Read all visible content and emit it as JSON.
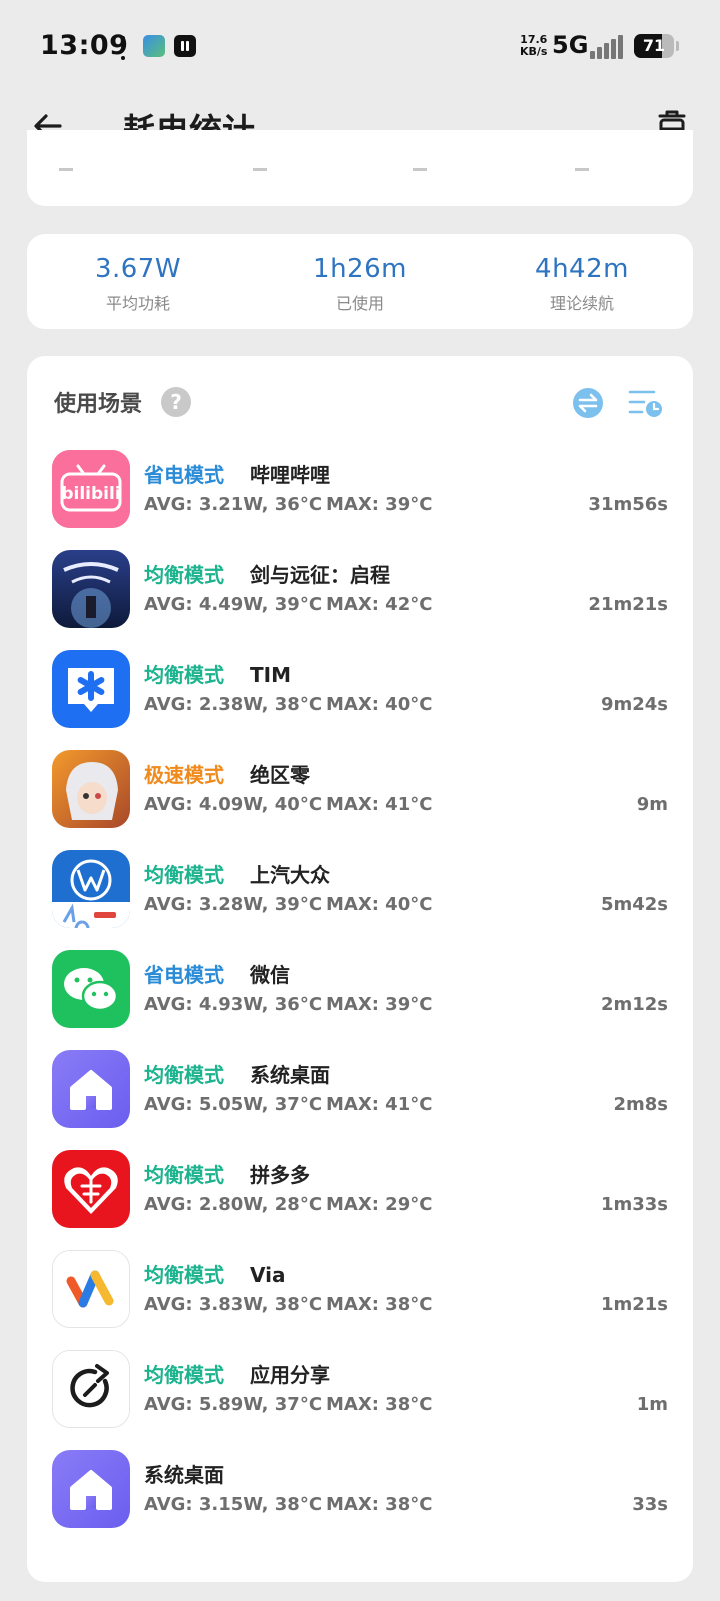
{
  "status_bar": {
    "time": "13:09",
    "net_speed_value": "17.6",
    "net_speed_unit": "KB/s",
    "network": "5G",
    "battery_level": "71",
    "battery_fraction": 0.71
  },
  "header": {
    "title": "耗电统计",
    "back_icon": "arrow-left-icon",
    "action_icon": "trash-icon"
  },
  "summary": [
    {
      "value": "3.67W",
      "label": "平均功耗"
    },
    {
      "value": "1h26m",
      "label": "已使用"
    },
    {
      "value": "4h42m",
      "label": "理论续航"
    }
  ],
  "scenes": {
    "title": "使用场景",
    "help_glyph": "?",
    "apps": [
      {
        "mode": "省电模式",
        "mode_color": "#2a8bd6",
        "name": "哔哩哔哩",
        "avg": "AVG: 3.21W, 36°C",
        "max": "MAX:  39°C",
        "duration": "31m56s",
        "icon": "bilibili-icon",
        "icon_text": "bilibili"
      },
      {
        "mode": "均衡模式",
        "mode_color": "#1db38e",
        "name": "剑与远征：启程",
        "avg": "AVG: 4.49W, 39°C",
        "max": "MAX:  42°C",
        "duration": "21m21s",
        "icon": "afk-journey-icon",
        "icon_text": ""
      },
      {
        "mode": "均衡模式",
        "mode_color": "#1db38e",
        "name": "TIM",
        "avg": "AVG: 2.38W, 38°C",
        "max": "MAX:  40°C",
        "duration": "9m24s",
        "icon": "tim-icon",
        "icon_text": ""
      },
      {
        "mode": "极速模式",
        "mode_color": "#f08a1c",
        "name": "绝区零",
        "avg": "AVG: 4.09W, 40°C",
        "max": "MAX:  41°C",
        "duration": "9m",
        "icon": "zenless-zone-zero-icon",
        "icon_text": ""
      },
      {
        "mode": "均衡模式",
        "mode_color": "#1db38e",
        "name": "上汽大众",
        "avg": "AVG: 3.28W, 39°C",
        "max": "MAX:  40°C",
        "duration": "5m42s",
        "icon": "volkswagen-icon",
        "icon_text": ""
      },
      {
        "mode": "省电模式",
        "mode_color": "#2a8bd6",
        "name": "微信",
        "avg": "AVG: 4.93W, 36°C",
        "max": "MAX:  39°C",
        "duration": "2m12s",
        "icon": "wechat-icon",
        "icon_text": ""
      },
      {
        "mode": "均衡模式",
        "mode_color": "#1db38e",
        "name": "系统桌面",
        "avg": "AVG: 5.05W, 37°C",
        "max": "MAX:  41°C",
        "duration": "2m8s",
        "icon": "launcher-home-icon",
        "icon_text": ""
      },
      {
        "mode": "均衡模式",
        "mode_color": "#1db38e",
        "name": "拼多多",
        "avg": "AVG: 2.80W, 28°C",
        "max": "MAX:  29°C",
        "duration": "1m33s",
        "icon": "pinduoduo-icon",
        "icon_text": ""
      },
      {
        "mode": "均衡模式",
        "mode_color": "#1db38e",
        "name": "Via",
        "avg": "AVG: 3.83W, 38°C",
        "max": "MAX:  38°C",
        "duration": "1m21s",
        "icon": "via-browser-icon",
        "icon_text": ""
      },
      {
        "mode": "均衡模式",
        "mode_color": "#1db38e",
        "name": "应用分享",
        "avg": "AVG: 5.89W, 37°C",
        "max": "MAX:  38°C",
        "duration": "1m",
        "icon": "app-share-icon",
        "icon_text": ""
      },
      {
        "mode": "",
        "mode_color": "#1db38e",
        "name": "系统桌面",
        "avg": "AVG: 3.15W, 38°C",
        "max": "MAX:  38°C",
        "duration": "33s",
        "icon": "launcher-home-icon",
        "icon_text": ""
      }
    ]
  },
  "colors": {
    "accent_blue": "#2f74c0",
    "power_save": "#2a8bd6",
    "balanced": "#1db38e",
    "performance": "#f08a1c"
  }
}
